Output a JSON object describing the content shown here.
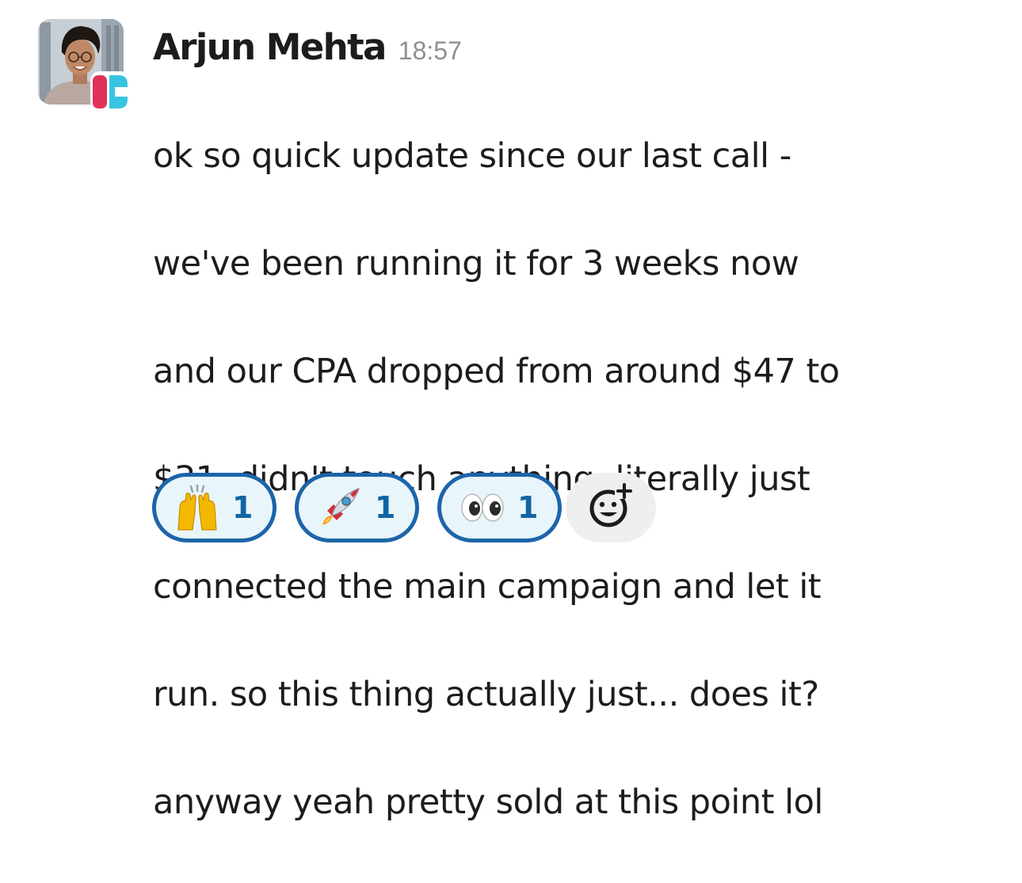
{
  "message": {
    "author": "Arjun Mehta",
    "timestamp": "18:57",
    "text_lines": [
      "ok so quick update since our last call -",
      "we've been running it for 3 weeks now",
      "and our CPA dropped from around $47 to",
      "$31. didn't touch anything. literally just",
      "connected the main campaign and let it",
      "run. so this thing actually just... does it?",
      "anyway yeah pretty sold at this point lol"
    ]
  },
  "reactions": [
    {
      "icon": "raising-hands-icon",
      "count": "1"
    },
    {
      "icon": "rocket-icon",
      "count": "1"
    },
    {
      "icon": "eyes-icon",
      "count": "1"
    }
  ],
  "add_reaction": {
    "icon": "add-reaction-smiley-icon"
  },
  "colors": {
    "author": "#1d1c1d",
    "timestamp": "#8f8f8f",
    "reaction_border": "#1d64a9",
    "reaction_bg": "#e8f5fa",
    "reaction_count": "#1264a3",
    "add_reaction_bg": "#efefef"
  }
}
